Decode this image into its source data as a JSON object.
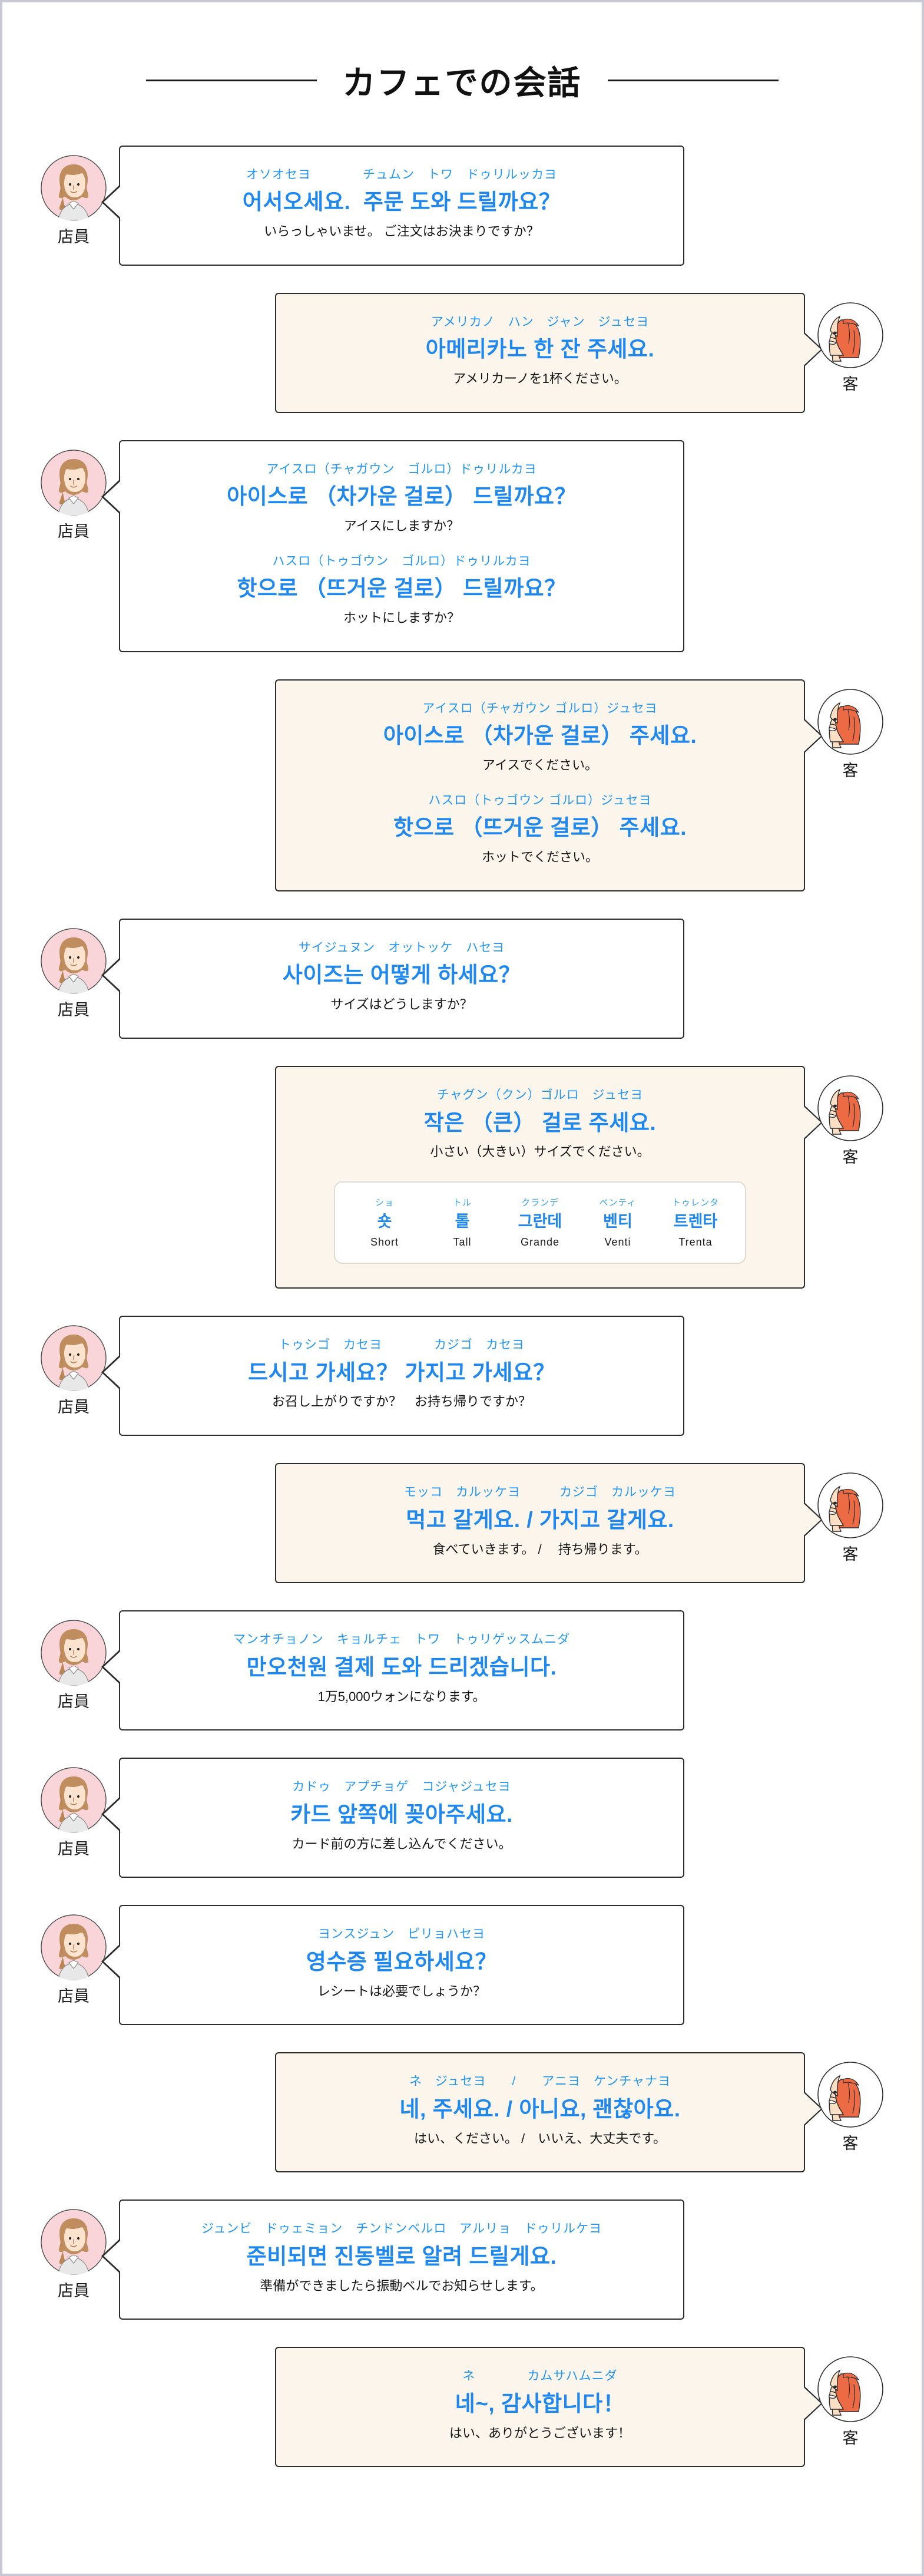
{
  "header": {
    "title": "カフェでの会話",
    "left_rule": "decorative-line",
    "right_rule": "decorative-line"
  },
  "speakers": {
    "staff": {
      "label": "店員",
      "avatar": "staff-avatar-woman-ponytail",
      "bubble_color": "#ffffff"
    },
    "customer": {
      "label": "客",
      "avatar": "customer-avatar-woman-orange-hair",
      "bubble_color": "#fbf5ec"
    }
  },
  "colors": {
    "kana": "#2196f3",
    "korean": "#1e88f0",
    "japanese": "#141414",
    "bubble_border": "#2b2b2b",
    "customer_bubble_bg": "#fbf5ec",
    "staff_avatar_bg": "#f8d2d6",
    "customer_hair": "#ec6b45"
  },
  "turns": [
    {
      "speaker": "staff",
      "lines": [
        {
          "kana": "オソオセヨ　　　　チュムン　トワ　ドゥリルッカヨ",
          "korean": "어서오세요.  주문 도와 드릴까요？",
          "japanese": "いらっしゃいませ。 ご注文はお決まりですか？"
        }
      ]
    },
    {
      "speaker": "customer",
      "lines": [
        {
          "kana": "アメリカノ　ハン　ジャン　ジュセヨ",
          "korean": "아메리카노 한 잔 주세요.",
          "japanese": "アメリカーノを1杯ください。"
        }
      ]
    },
    {
      "speaker": "staff",
      "lines": [
        {
          "kana": "アイスロ（チャガウン　ゴルロ）ドゥリルカヨ",
          "korean": "아이스로 （차가운 걸로） 드릴까요？",
          "japanese": "アイスにしますか？"
        },
        {
          "kana": "ハスロ（トゥゴウン　ゴルロ）ドゥリルカヨ",
          "korean": "핫으로 （뜨거운 걸로） 드릴까요？",
          "japanese": "ホットにしますか？"
        }
      ]
    },
    {
      "speaker": "customer",
      "lines": [
        {
          "kana": "アイスロ（チャガウン ゴルロ）ジュセヨ",
          "korean": "아이스로 （차가운 걸로） 주세요.",
          "japanese": "アイスでください。"
        },
        {
          "kana": "ハスロ（トゥゴウン ゴルロ）ジュセヨ",
          "korean": "핫으로 （뜨거운 걸로） 주세요.",
          "japanese": "ホットでください。"
        }
      ]
    },
    {
      "speaker": "staff",
      "lines": [
        {
          "kana": "サイジュヌン　オットッケ　ハセヨ",
          "korean": "사이즈는 어떻게 하세요？",
          "japanese": "サイズはどうしますか？"
        }
      ]
    },
    {
      "speaker": "customer",
      "has_size_card": true,
      "lines": [
        {
          "kana": "チャグン（クン）ゴルロ　ジュセヨ",
          "korean": "작은 （큰） 걸로 주세요.",
          "japanese": "小さい（大きい）サイズでください。"
        }
      ]
    },
    {
      "speaker": "staff",
      "lines": [
        {
          "kana": "トゥシゴ　カセヨ　　　　カジゴ　カセヨ",
          "korean": "드시고 가세요？ 가지고 가세요？",
          "japanese": "お召し上がりですか？　お持ち帰りですか？"
        }
      ]
    },
    {
      "speaker": "customer",
      "lines": [
        {
          "kana": "モッコ　カルッケヨ　　　カジゴ　カルッケヨ",
          "korean": "먹고 갈게요. / 가지고 갈게요.",
          "japanese": "食べていきます。 / 　持ち帰ります。"
        }
      ]
    },
    {
      "speaker": "staff",
      "lines": [
        {
          "kana": "マンオチョノン　キョルチェ　トワ　トゥリゲッスムニダ",
          "korean": "만오천원 결제 도와 드리겠습니다.",
          "japanese": "1万5,000ウォンになります。"
        }
      ]
    },
    {
      "speaker": "staff",
      "lines": [
        {
          "kana": "カドゥ　アプチョゲ　コジャジュセヨ",
          "korean": "카드 앞쪽에 꽂아주세요.",
          "japanese": "カード前の方に差し込んでください。"
        }
      ]
    },
    {
      "speaker": "staff",
      "lines": [
        {
          "kana": "ヨンスジュン　ピリョハセヨ",
          "korean": "영수증 필요하세요？",
          "japanese": "レシートは必要でしょうか？"
        }
      ]
    },
    {
      "speaker": "customer",
      "lines": [
        {
          "kana": "ネ　ジュセヨ　　/　　アニヨ　ケンチャナヨ",
          "korean": "네, 주세요. / 아니요, 괜찮아요.",
          "japanese": "はい、ください。 /　いいえ、大丈夫です。"
        }
      ]
    },
    {
      "speaker": "staff",
      "lines": [
        {
          "kana": "ジュンビ　ドゥェミョン　チンドンベルロ　アルリョ　ドゥリルケヨ",
          "korean": "준비되면 진동벨로 알려 드릴게요.",
          "japanese": "準備ができましたら振動ベルでお知らせします。"
        }
      ]
    },
    {
      "speaker": "customer",
      "lines": [
        {
          "kana": "ネ　　　　カムサハムニダ",
          "korean": "네~, 감사합니다！",
          "japanese": "はい、ありがとうございます！"
        }
      ]
    }
  ],
  "size_card": {
    "cells": [
      {
        "kana": "ショ",
        "korean": "숏",
        "english": "Short"
      },
      {
        "kana": "トル",
        "korean": "톨",
        "english": "Tall"
      },
      {
        "kana": "クランデ",
        "korean": "그란데",
        "english": "Grande"
      },
      {
        "kana": "ベンティ",
        "korean": "벤티",
        "english": "Venti"
      },
      {
        "kana": "トゥレンタ",
        "korean": "트렌타",
        "english": "Trenta"
      }
    ]
  }
}
